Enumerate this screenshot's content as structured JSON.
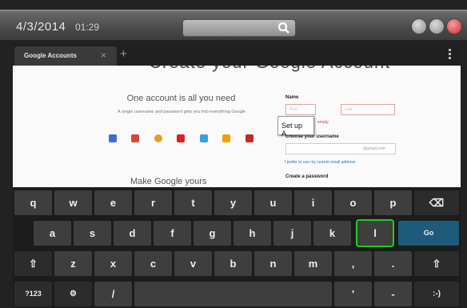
{
  "status": {
    "date": "4/3/2014",
    "time": "01:29"
  },
  "browser": {
    "tab_title": "Google Accounts",
    "close": "×",
    "new_tab": "+"
  },
  "page": {
    "banner": "Create your Google Account",
    "tagline": "One account is all you need",
    "subtitle": "A single username and password gets you into everything Google",
    "make_yours": "Make Google yours",
    "name_label": "Name",
    "first_placeholder": "First",
    "last_placeholder": "Last",
    "tooltip": "Set up A...",
    "tooltip_prefix": "Y",
    "error_text": "empty.",
    "choose_username": "Choose your username",
    "gmail_suffix": "@gmail.com",
    "use_email_link": "I prefer to use my current email address",
    "create_password": "Create a password"
  },
  "keyboard": {
    "row1": [
      "q",
      "w",
      "e",
      "r",
      "t",
      "y",
      "u",
      "i",
      "o",
      "p"
    ],
    "row2": [
      "a",
      "s",
      "d",
      "f",
      "g",
      "h",
      "j",
      "k",
      "l"
    ],
    "row3": [
      "z",
      "x",
      "c",
      "v",
      "b",
      "n",
      "m"
    ],
    "backspace": "⌫",
    "go": "Go",
    "shift": "⇧",
    "symbols": "?123",
    "settings": "⚙",
    "slash": "/",
    "smiley": ":-)",
    "comma": ",",
    "period": ".",
    "apostrophe": "'",
    "dash": "-"
  },
  "colors": {
    "go_key": "#1e5a7a",
    "highlight": "#22cc22"
  }
}
